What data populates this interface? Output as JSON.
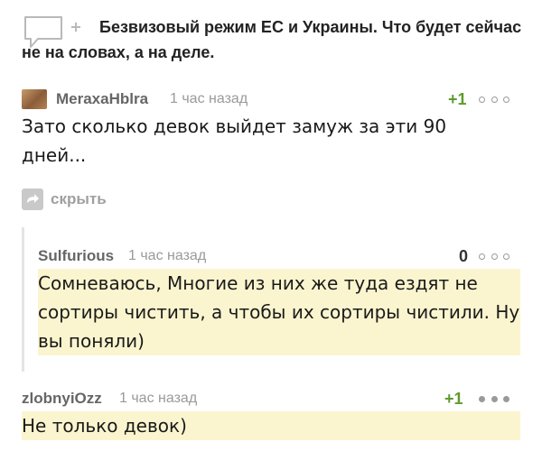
{
  "post": {
    "title": "Безвизовый режим ЕС и Украины. Что будет сейчас не на словах, а на деле."
  },
  "comments": [
    {
      "author": "MeraxaHblra",
      "time": "1 час назад",
      "rating": "+1",
      "text": "Зато сколько девок выйдет замуж за эти 90 дней..."
    },
    {
      "author": "Sulfurious",
      "time": "1 час назад",
      "rating": "0",
      "text": "Сомневаюсь, Многие из них же туда ездят не сортиры чистить, а чтобы их сортиры чистили. Ну вы поняли)"
    },
    {
      "author": "zlobnyiOzz",
      "time": "1 час назад",
      "rating": "+1",
      "text": "Не только девок)"
    }
  ],
  "actions": {
    "hide_label": "скрыть"
  }
}
